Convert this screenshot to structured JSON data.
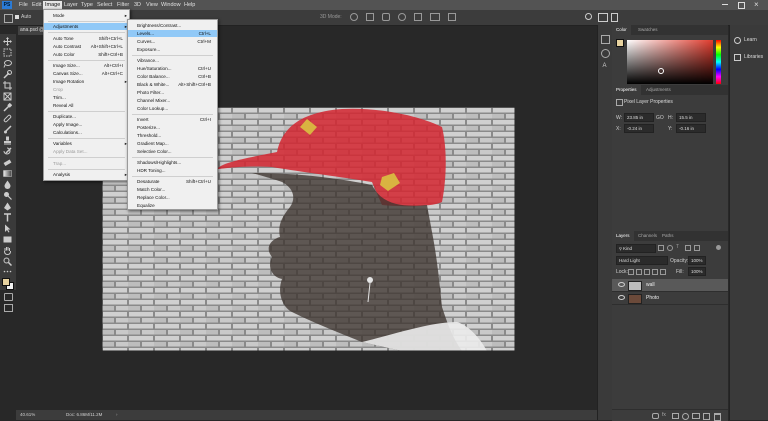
{
  "menubar": {
    "items": [
      "PS",
      "File",
      "Edit",
      "Image",
      "Layer",
      "Type",
      "Select",
      "Filter",
      "3D",
      "View",
      "Window",
      "Help"
    ],
    "active": "Image"
  },
  "options": {
    "left_label": "Auto",
    "mode_3d": "3D Mode:"
  },
  "document": {
    "tab": "ana.psd @",
    "status_zoom": "40.61%",
    "status_doc": "Doc: 6.86M/11.2M"
  },
  "image_menu": {
    "items": [
      {
        "label": "Mode",
        "shortcut": "",
        "submenu": true,
        "disabled": false
      },
      {
        "sep": true
      },
      {
        "label": "Adjustments",
        "shortcut": "",
        "submenu": true,
        "disabled": false,
        "highlight": true
      },
      {
        "sep": true
      },
      {
        "label": "Auto Tone",
        "shortcut": "Shift+Ctrl+L",
        "submenu": false,
        "disabled": false
      },
      {
        "label": "Auto Contrast",
        "shortcut": "Alt+Shift+Ctrl+L",
        "submenu": false,
        "disabled": false
      },
      {
        "label": "Auto Color",
        "shortcut": "Shift+Ctrl+B",
        "submenu": false,
        "disabled": false
      },
      {
        "sep": true
      },
      {
        "label": "Image Size...",
        "shortcut": "Alt+Ctrl+I",
        "submenu": false,
        "disabled": false
      },
      {
        "label": "Canvas Size...",
        "shortcut": "Alt+Ctrl+C",
        "submenu": false,
        "disabled": false
      },
      {
        "label": "Image Rotation",
        "shortcut": "",
        "submenu": true,
        "disabled": false
      },
      {
        "label": "Crop",
        "shortcut": "",
        "submenu": false,
        "disabled": true
      },
      {
        "label": "Trim...",
        "shortcut": "",
        "submenu": false,
        "disabled": false
      },
      {
        "label": "Reveal All",
        "shortcut": "",
        "submenu": false,
        "disabled": false
      },
      {
        "sep": true
      },
      {
        "label": "Duplicate...",
        "shortcut": "",
        "submenu": false,
        "disabled": false
      },
      {
        "label": "Apply Image...",
        "shortcut": "",
        "submenu": false,
        "disabled": false
      },
      {
        "label": "Calculations...",
        "shortcut": "",
        "submenu": false,
        "disabled": false
      },
      {
        "sep": true
      },
      {
        "label": "Variables",
        "shortcut": "",
        "submenu": true,
        "disabled": false
      },
      {
        "label": "Apply Data Set...",
        "shortcut": "",
        "submenu": false,
        "disabled": true
      },
      {
        "sep": true
      },
      {
        "label": "Trap...",
        "shortcut": "",
        "submenu": false,
        "disabled": true
      },
      {
        "sep": true
      },
      {
        "label": "Analysis",
        "shortcut": "",
        "submenu": true,
        "disabled": false
      }
    ]
  },
  "adjust_menu": {
    "items": [
      {
        "label": "Brightness/Contrast...",
        "shortcut": ""
      },
      {
        "label": "Levels...",
        "shortcut": "Ctrl+L",
        "highlight": true
      },
      {
        "label": "Curves...",
        "shortcut": "Ctrl+M"
      },
      {
        "label": "Exposure...",
        "shortcut": ""
      },
      {
        "sep": true
      },
      {
        "label": "Vibrance...",
        "shortcut": ""
      },
      {
        "label": "Hue/Saturation...",
        "shortcut": "Ctrl+U"
      },
      {
        "label": "Color Balance...",
        "shortcut": "Ctrl+B"
      },
      {
        "label": "Black & White...",
        "shortcut": "Alt+Shift+Ctrl+B"
      },
      {
        "label": "Photo Filter...",
        "shortcut": ""
      },
      {
        "label": "Channel Mixer...",
        "shortcut": ""
      },
      {
        "label": "Color Lookup...",
        "shortcut": ""
      },
      {
        "sep": true
      },
      {
        "label": "Invert",
        "shortcut": "Ctrl+I"
      },
      {
        "label": "Posterize...",
        "shortcut": ""
      },
      {
        "label": "Threshold...",
        "shortcut": ""
      },
      {
        "label": "Gradient Map...",
        "shortcut": ""
      },
      {
        "label": "Selective Color...",
        "shortcut": ""
      },
      {
        "sep": true
      },
      {
        "label": "Shadows/Highlights...",
        "shortcut": ""
      },
      {
        "label": "HDR Toning...",
        "shortcut": ""
      },
      {
        "sep": true
      },
      {
        "label": "Desaturate",
        "shortcut": "Shift+Ctrl+U"
      },
      {
        "label": "Match Color...",
        "shortcut": ""
      },
      {
        "label": "Replace Color...",
        "shortcut": ""
      },
      {
        "label": "Equalize",
        "shortcut": ""
      }
    ]
  },
  "color_panel": {
    "tabs": [
      "Color",
      "Swatches"
    ]
  },
  "properties_panel": {
    "tabs": [
      "Properties",
      "Adjustments"
    ],
    "subtitle": "Pixel Layer Properties",
    "w_label": "W:",
    "w_value": "23.85 in",
    "h_label": "H:",
    "h_value": "15.5 in",
    "x_label": "X:",
    "x_value": "-0.24 in",
    "y_label": "Y:",
    "y_value": "-0.16 in",
    "link_label": "GO"
  },
  "layers_panel": {
    "tabs": [
      "Layers",
      "Channels",
      "Paths"
    ],
    "filter_kind": "Kind",
    "blend_mode": "Hard Light",
    "opacity_label": "Opacity:",
    "opacity_value": "100%",
    "lock_label": "Lock:",
    "fill_label": "Fill:",
    "fill_value": "100%",
    "layers": [
      {
        "name": "wall",
        "selected": true
      },
      {
        "name": "Photo",
        "selected": false
      }
    ]
  },
  "side_panel": {
    "items": [
      "Learn",
      "Libraries"
    ]
  },
  "colors": {
    "app_bg": "#282828",
    "panel_bg": "#3c3c3c",
    "menu_bg": "#f0f0f0",
    "menu_highlight": "#91c9f7",
    "cap_red": "#d32630"
  }
}
